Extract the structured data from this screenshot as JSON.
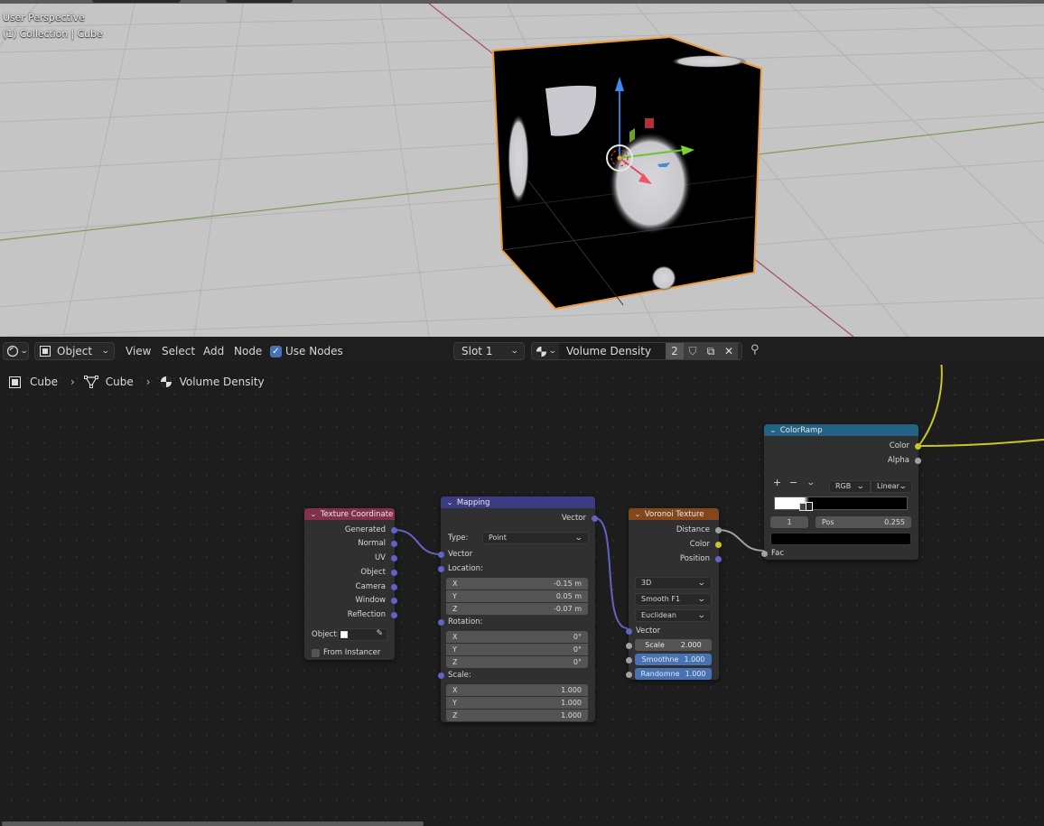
{
  "viewport": {
    "view_name": "User Perspective",
    "collection_label": "(1) Collection | Cube"
  },
  "header": {
    "editor_type_icon": "shader-editor-icon",
    "mode": "Object",
    "menus": [
      "View",
      "Select",
      "Add",
      "Node"
    ],
    "use_nodes_label": "Use Nodes",
    "use_nodes_checked": true,
    "slot": "Slot 1",
    "material_name": "Volume Density",
    "user_count": "2"
  },
  "breadcrumb": {
    "items": [
      {
        "icon": "object-icon",
        "label": "Cube"
      },
      {
        "icon": "mesh-icon",
        "label": "Cube"
      },
      {
        "icon": "material-icon",
        "label": "Volume Density"
      }
    ]
  },
  "nodes": {
    "texcoord": {
      "title": "Texture Coordinate",
      "header_color": "#83314a",
      "outputs": [
        "Generated",
        "Normal",
        "UV",
        "Object",
        "Camera",
        "Window",
        "Reflection"
      ],
      "object_label": "Object:",
      "from_instancer_label": "From Instancer"
    },
    "mapping": {
      "title": "Mapping",
      "header_color": "#3c3c83",
      "output": "Vector",
      "type_label": "Type:",
      "type_value": "Point",
      "vector_label": "Vector",
      "location_label": "Location:",
      "location": [
        {
          "axis": "X",
          "value": "-0.15 m"
        },
        {
          "axis": "Y",
          "value": "0.05 m"
        },
        {
          "axis": "Z",
          "value": "-0.07 m"
        }
      ],
      "rotation_label": "Rotation:",
      "rotation": [
        {
          "axis": "X",
          "value": "0°"
        },
        {
          "axis": "Y",
          "value": "0°"
        },
        {
          "axis": "Z",
          "value": "0°"
        }
      ],
      "scale_label": "Scale:",
      "scale": [
        {
          "axis": "X",
          "value": "1.000"
        },
        {
          "axis": "Y",
          "value": "1.000"
        },
        {
          "axis": "Z",
          "value": "1.000"
        }
      ]
    },
    "voronoi": {
      "title": "Voronoi Texture",
      "header_color": "#83471c",
      "outputs": [
        "Distance",
        "Color",
        "Position"
      ],
      "dimensions": "3D",
      "feature": "Smooth F1",
      "metric": "Euclidean",
      "vector_label": "Vector",
      "scale_label": "Scale",
      "scale_value": "2.000",
      "smoothness_label": "Smoothne",
      "smoothness_value": "1.000",
      "randomness_label": "Randomne",
      "randomness_value": "1.000"
    },
    "colorramp": {
      "title": "ColorRamp",
      "header_color": "#246283",
      "outputs": [
        "Color",
        "Alpha"
      ],
      "add_label": "+",
      "remove_label": "−",
      "color_mode": "RGB",
      "interpolation": "Linear",
      "active_stop": "1",
      "pos_label": "Pos",
      "pos_value": "0.255",
      "stop_color": "#000000",
      "fac_label": "Fac"
    }
  }
}
